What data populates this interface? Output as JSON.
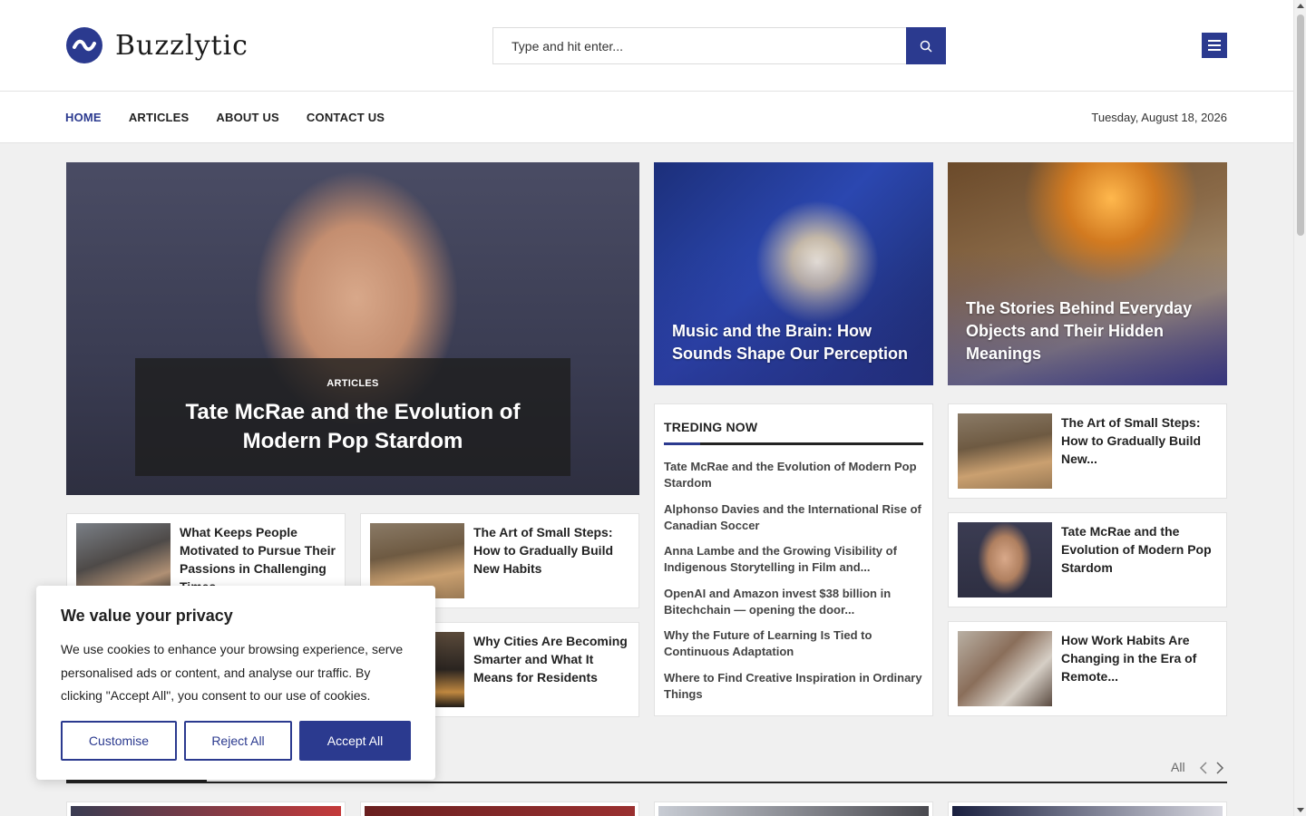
{
  "site": {
    "name": "Buzzlytic"
  },
  "search": {
    "placeholder": "Type and hit enter..."
  },
  "nav": {
    "items": [
      "HOME",
      "ARTICLES",
      "ABOUT US",
      "CONTACT US"
    ],
    "active": "HOME",
    "date": "Tuesday, August 18, 2026"
  },
  "hero": {
    "category": "ARTICLES",
    "title": "Tate McRae and the Evolution of Modern Pop Stardom"
  },
  "feature_cards": [
    {
      "title": "Music and the Brain: How Sounds Shape Our Perception"
    },
    {
      "title": "The Stories Behind Everyday Objects and Their Hidden Meanings"
    }
  ],
  "posts_left": [
    {
      "title": "What Keeps People Motivated to Pursue Their Passions in Challenging Times"
    },
    {
      "title": "The Art of Small Steps: How to Gradually Build New Habits"
    },
    {
      "title": "Why Cities Are Becoming Smarter and What It Means for Residents"
    }
  ],
  "trending": {
    "heading": "TREDING NOW",
    "items": [
      "Tate McRae and the Evolution of Modern Pop Stardom",
      "Alphonso Davies and the International Rise of Canadian Soccer",
      "Anna Lambe and the Growing Visibility of Indigenous Storytelling in Film and...",
      "OpenAI and Amazon invest $38 billion in Bitechchain — opening the door...",
      "Why the Future of Learning Is Tied to Continuous Adaptation",
      "Where to Find Creative Inspiration in Ordinary Things"
    ]
  },
  "posts_right": [
    {
      "title": "The Art of Small Steps: How to Gradually Build New..."
    },
    {
      "title": "Tate McRae and the Evolution of Modern Pop Stardom"
    },
    {
      "title": "How Work Habits Are Changing in the Era of Remote..."
    }
  ],
  "section": {
    "all_label": "All"
  },
  "cookie": {
    "title": "We value your privacy",
    "body": "We use cookies to enhance your browsing experience, serve personalised ads or content, and analyse our traffic. By clicking \"Accept All\", you consent to our use of cookies.",
    "customise": "Customise",
    "reject": "Reject All",
    "accept": "Accept All"
  },
  "colors": {
    "brand": "#2b3a8f",
    "text": "#222222",
    "background": "#f0f0f0"
  }
}
